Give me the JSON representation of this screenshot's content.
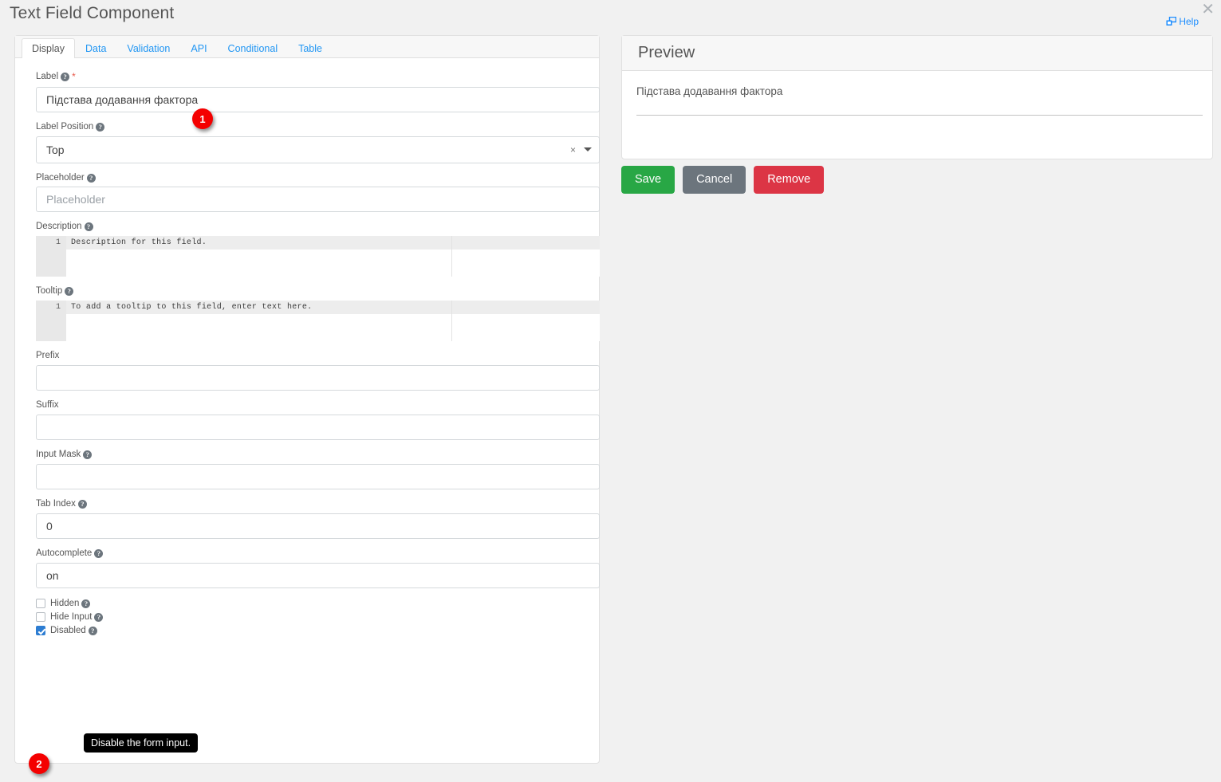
{
  "window": {
    "title": "Text Field Component",
    "help_label": "Help",
    "help_icon": "external-window-icon",
    "close_icon": "close-icon"
  },
  "tabs": [
    {
      "label": "Display",
      "active": true
    },
    {
      "label": "Data",
      "active": false
    },
    {
      "label": "Validation",
      "active": false
    },
    {
      "label": "API",
      "active": false
    },
    {
      "label": "Conditional",
      "active": false
    },
    {
      "label": "Table",
      "active": false
    }
  ],
  "form": {
    "label_field": {
      "label": "Label",
      "required_marker": "*",
      "help_icon": "question-mark-icon",
      "value": "Підстава додавання фактора"
    },
    "label_position": {
      "label": "Label Position",
      "help_icon": "question-mark-icon",
      "value": "Top",
      "clear_icon": "×",
      "caret_icon": "chevron-down-icon"
    },
    "placeholder": {
      "label": "Placeholder",
      "help_icon": "question-mark-icon",
      "value": "",
      "placeholder": "Placeholder"
    },
    "description": {
      "label": "Description",
      "help_icon": "question-mark-icon",
      "line_number": "1",
      "value": "Description for this field."
    },
    "tooltip_editor": {
      "label": "Tooltip",
      "help_icon": "question-mark-icon",
      "line_number": "1",
      "value": "To add a tooltip to this field, enter text here."
    },
    "prefix": {
      "label": "Prefix",
      "value": ""
    },
    "suffix": {
      "label": "Suffix",
      "value": ""
    },
    "input_mask": {
      "label": "Input Mask",
      "help_icon": "question-mark-icon",
      "value": ""
    },
    "tab_index": {
      "label": "Tab Index",
      "help_icon": "question-mark-icon",
      "value": "0"
    },
    "autocomplete": {
      "label": "Autocomplete",
      "help_icon": "question-mark-icon",
      "value": "on"
    },
    "checkboxes": [
      {
        "label": "Hidden",
        "checked": false,
        "help_icon": "question-mark-icon"
      },
      {
        "label": "Hide Input",
        "checked": false,
        "help_icon": "question-mark-icon"
      },
      {
        "label": "Disabled",
        "checked": true,
        "help_icon": "question-mark-icon"
      }
    ]
  },
  "tooltip": {
    "text": "Disable the form input."
  },
  "badges": [
    {
      "number": "1"
    },
    {
      "number": "2"
    }
  ],
  "preview": {
    "title": "Preview",
    "field_label": "Підстава додавання фактора"
  },
  "actions": {
    "save": "Save",
    "cancel": "Cancel",
    "remove": "Remove"
  },
  "colors": {
    "accent_link": "#2196f3",
    "save": "#28a745",
    "cancel": "#6c757d",
    "remove": "#dc3545",
    "badge": "#f40000",
    "checkbox_checked": "#2d7dd2",
    "required": "#e8594a"
  }
}
